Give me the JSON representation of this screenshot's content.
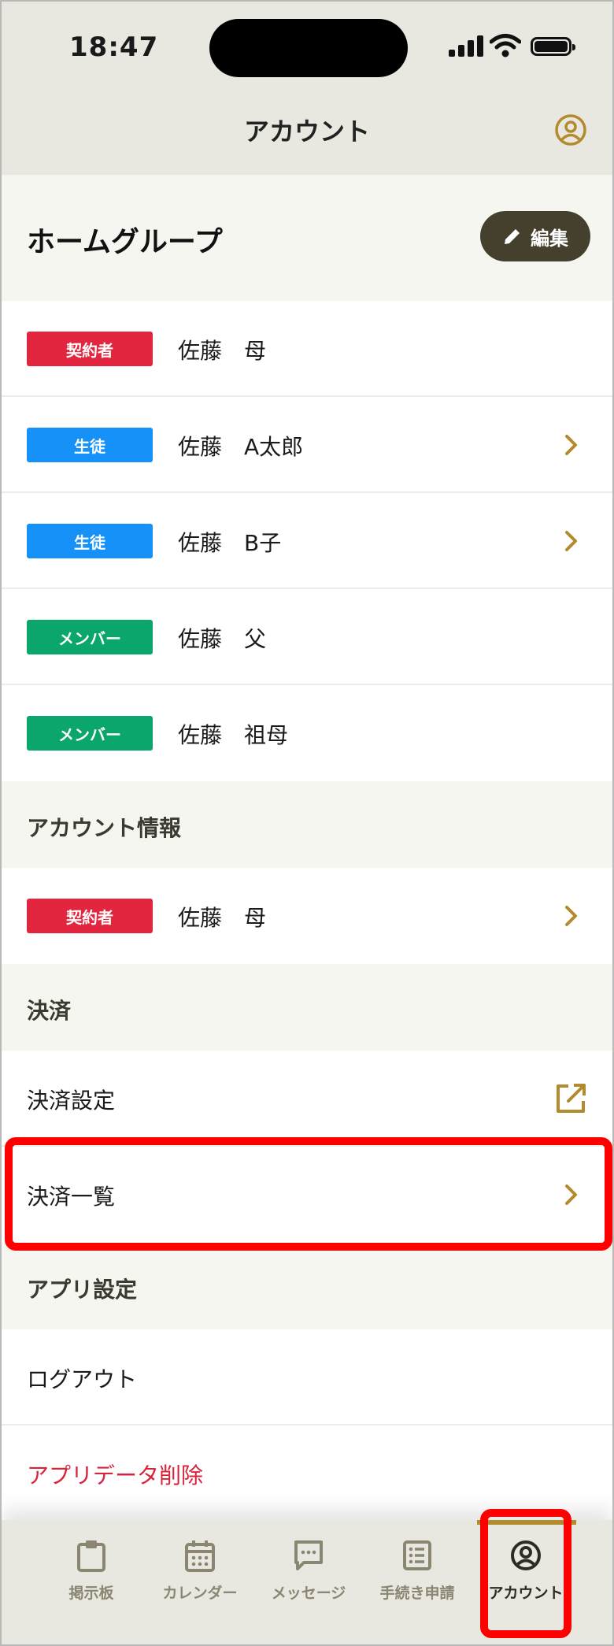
{
  "status_bar": {
    "time": "18:47"
  },
  "header": {
    "title": "アカウント",
    "account_icon": "user-circle-icon"
  },
  "home_group": {
    "title": "ホームグループ",
    "edit_label": "編集",
    "members": [
      {
        "badge": "契約者",
        "badge_color": "#e2263f",
        "name": "佐藤　母",
        "has_chevron": false
      },
      {
        "badge": "生徒",
        "badge_color": "#1591f7",
        "name": "佐藤　A太郎",
        "has_chevron": true
      },
      {
        "badge": "生徒",
        "badge_color": "#1591f7",
        "name": "佐藤　B子",
        "has_chevron": true
      },
      {
        "badge": "メンバー",
        "badge_color": "#0aa66c",
        "name": "佐藤　父",
        "has_chevron": false
      },
      {
        "badge": "メンバー",
        "badge_color": "#0aa66c",
        "name": "佐藤　祖母",
        "has_chevron": false
      }
    ]
  },
  "account_info": {
    "title": "アカウント情報",
    "row": {
      "badge": "契約者",
      "badge_color": "#e2263f",
      "name": "佐藤　母"
    }
  },
  "payment": {
    "title": "決済",
    "settings_label": "決済設定",
    "list_label": "決済一覧"
  },
  "app_settings": {
    "title": "アプリ設定",
    "logout_label": "ログアウト",
    "delete_label": "アプリデータ削除",
    "delete_color": "#d9233c"
  },
  "tabbar": {
    "accent": "#b38b2e",
    "tabs": [
      {
        "label": "掲示板",
        "icon": "clipboard-icon"
      },
      {
        "label": "カレンダー",
        "icon": "calendar-icon"
      },
      {
        "label": "メッセージ",
        "icon": "message-icon"
      },
      {
        "label": "手続き申請",
        "icon": "list-icon"
      },
      {
        "label": "アカウント",
        "icon": "user-circle-icon",
        "active": true
      }
    ]
  }
}
